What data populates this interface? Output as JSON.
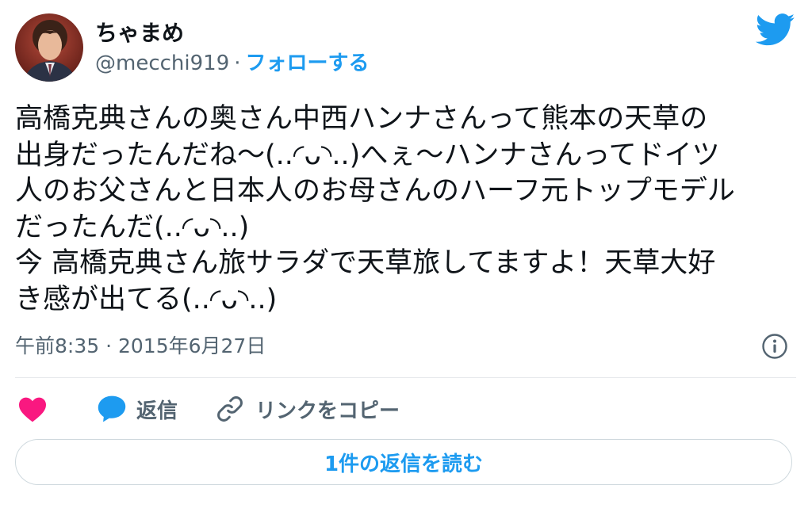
{
  "user": {
    "display_name": "ちゃまめ",
    "handle": "@mecchi919",
    "separator": "·",
    "follow_label": "フォローする"
  },
  "tweet": {
    "lines": [
      "高橋克典さんの奥さん中西ハンナさんって熊本の天草の",
      "出身だったんだね〜(..◜ᴗ◝..)へぇ〜ハンナさんってドイツ",
      "人のお父さんと日本人のお母さんのハーフ元トップモデル",
      "だったんだ(..◜ᴗ◝..)",
      "今 高橋克典さん旅サラダで天草旅してますよ！天草大好",
      "き感が出てる(..◜ᴗ◝..)"
    ],
    "timestamp": "午前8:35 · 2015年6月27日"
  },
  "actions": {
    "reply_label": "返信",
    "copy_link_label": "リンクをコピー"
  },
  "read_replies_label": "1件の返信を読む",
  "icons": {
    "bird": "twitter-bird-icon",
    "info": "info-icon",
    "like": "heart-icon",
    "reply": "speech-bubble-icon",
    "copy": "link-icon"
  },
  "colors": {
    "accent": "#1d9bf0",
    "like": "#f91880",
    "secondary_text": "#536471",
    "text": "#0f1419"
  }
}
